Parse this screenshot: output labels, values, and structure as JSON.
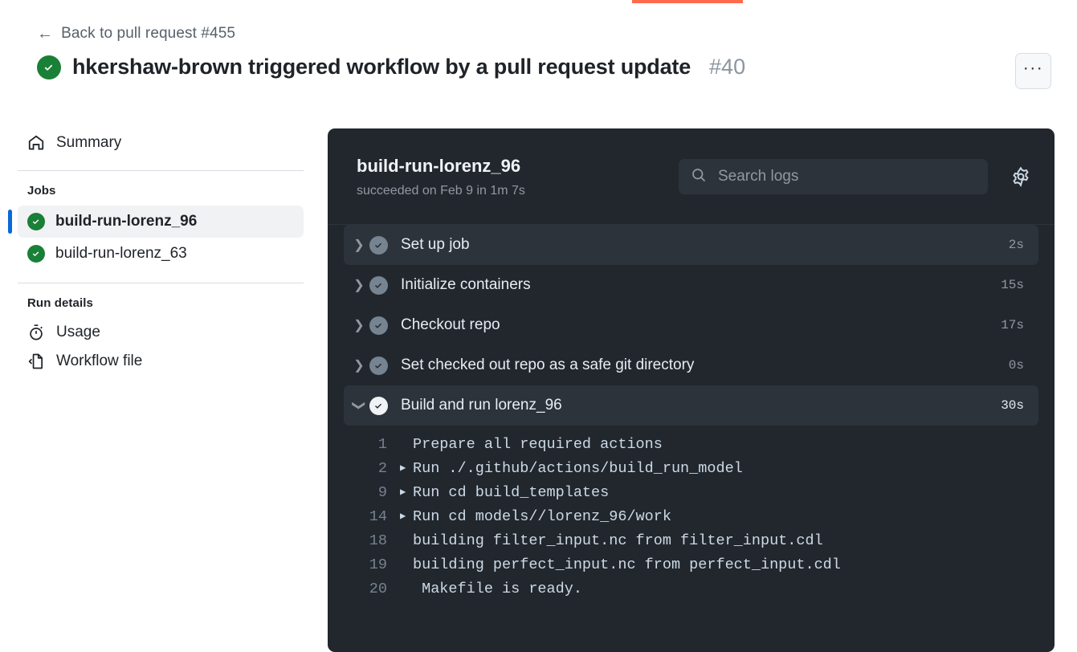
{
  "browser": {
    "loading_bar_color": "#ff6a4d"
  },
  "header": {
    "back_link": "Back to pull request #455",
    "back_icon": "arrow-left-icon",
    "status_icon": "check-circle-green-icon",
    "title": "hkershaw-brown triggered workflow by a pull request update",
    "run_number": "#40",
    "kebab_label": "···"
  },
  "sidebar": {
    "summary": {
      "label": "Summary",
      "icon": "home-icon"
    },
    "jobs_heading": "Jobs",
    "jobs": [
      {
        "label": "build-run-lorenz_96",
        "icon": "check-circle-green-icon",
        "selected": true
      },
      {
        "label": "build-run-lorenz_63",
        "icon": "check-circle-green-icon",
        "selected": false
      }
    ],
    "run_details_heading": "Run details",
    "run_details": [
      {
        "label": "Usage",
        "icon": "stopwatch-icon"
      },
      {
        "label": "Workflow file",
        "icon": "file-code-icon"
      }
    ]
  },
  "logs_panel": {
    "job_name": "build-run-lorenz_96",
    "job_status": "succeeded on Feb 9 in 1m 7s",
    "search": {
      "placeholder": "Search logs",
      "value": "",
      "icon": "search-icon"
    },
    "settings_icon": "gear-icon",
    "steps": [
      {
        "label": "Set up job",
        "duration": "2s",
        "state": "collapsed",
        "highlighted": true,
        "icon": "check-circle-icon",
        "caret": "chevron-right-icon"
      },
      {
        "label": "Initialize containers",
        "duration": "15s",
        "state": "collapsed",
        "highlighted": false,
        "icon": "check-circle-icon",
        "caret": "chevron-right-icon"
      },
      {
        "label": "Checkout repo",
        "duration": "17s",
        "state": "collapsed",
        "highlighted": false,
        "icon": "check-circle-icon",
        "caret": "chevron-right-icon"
      },
      {
        "label": "Set checked out repo as a safe git directory",
        "duration": "0s",
        "state": "collapsed",
        "highlighted": false,
        "icon": "check-circle-icon",
        "caret": "chevron-right-icon"
      },
      {
        "label": "Build and run lorenz_96",
        "duration": "30s",
        "state": "expanded",
        "highlighted": true,
        "icon": "check-circle-icon",
        "caret": "chevron-down-icon"
      }
    ],
    "log_lines": [
      {
        "number": "1",
        "group": false,
        "text": "Prepare all required actions"
      },
      {
        "number": "2",
        "group": true,
        "text": "Run ./.github/actions/build_run_model"
      },
      {
        "number": "9",
        "group": true,
        "text": "Run cd build_templates"
      },
      {
        "number": "14",
        "group": true,
        "text": "Run cd models//lorenz_96/work"
      },
      {
        "number": "18",
        "group": false,
        "text": "building filter_input.nc from filter_input.cdl"
      },
      {
        "number": "19",
        "group": false,
        "text": "building perfect_input.nc from perfect_input.cdl"
      },
      {
        "number": "20",
        "group": false,
        "text": " Makefile is ready."
      }
    ]
  },
  "colors": {
    "success_green": "#1a7f37",
    "accent_blue": "#0969da",
    "panel_dark": "#22272e",
    "panel_row_hl": "#2d333b"
  }
}
